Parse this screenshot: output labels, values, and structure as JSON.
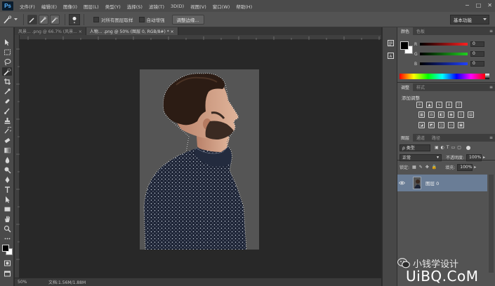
{
  "app": {
    "logo": "Ps"
  },
  "menu": [
    "文件(F)",
    "编辑(E)",
    "图像(I)",
    "图层(L)",
    "类型(Y)",
    "选择(S)",
    "滤镜(T)",
    "3D(D)",
    "视图(V)",
    "窗口(W)",
    "帮助(H)"
  ],
  "window_controls": {
    "minimize": "−",
    "restore": "□",
    "close": "✕"
  },
  "options": {
    "sample_all_layers": "对所有图层取样",
    "auto_enhance": "自动增强",
    "refine_edge": "调整边缘...",
    "workspace": "基本功能"
  },
  "tabs": [
    {
      "label": "风景... .png @ 66.7% (风景... ×"
    },
    {
      "label": "人物... .png @ 50% (图层 0, RGB/8#) * ×"
    }
  ],
  "status": {
    "zoom": "50%",
    "doc_info": "文档:1.56M/1.88M"
  },
  "color_panel": {
    "tabs": [
      "颜色",
      "色板"
    ],
    "channels": [
      {
        "label": "R",
        "value": "0",
        "color": "#d02020"
      },
      {
        "label": "G",
        "value": "0",
        "color": "#20b020"
      },
      {
        "label": "B",
        "value": "0",
        "color": "#2040d0"
      }
    ]
  },
  "adjustments_panel": {
    "tabs": [
      "调整",
      "样式"
    ],
    "title": "添加调整"
  },
  "layers_panel": {
    "tabs": [
      "图层",
      "通道",
      "路径"
    ],
    "filter_kind": "ρ 类型",
    "blend_mode": "正常",
    "opacity_label": "不透明度:",
    "opacity_value": "100%",
    "lock_label": "锁定:",
    "fill_label": "填充:",
    "fill_value": "100%",
    "layers": [
      {
        "name": "图层 0"
      }
    ]
  },
  "watermark": {
    "line1": "小钱学设计",
    "line2": "UiBQ.CoM"
  }
}
